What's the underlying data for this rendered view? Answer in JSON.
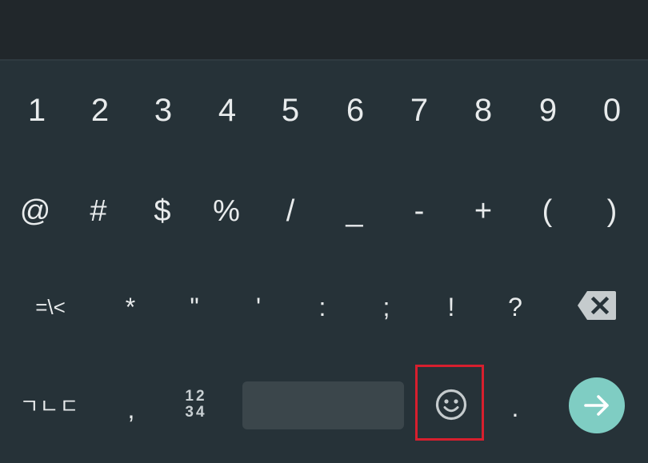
{
  "keyboard": {
    "row1": [
      "1",
      "2",
      "3",
      "4",
      "5",
      "6",
      "7",
      "8",
      "9",
      "0"
    ],
    "row2": [
      "@",
      "#",
      "$",
      "%",
      "/",
      "_",
      "-",
      "+",
      "(",
      ")"
    ],
    "row3": [
      "=\\<",
      "*",
      "\"",
      "'",
      ":",
      ";",
      "!",
      "?"
    ],
    "row4": {
      "language_key": "ㄱㄴㄷ",
      "comma": ",",
      "symbols_key_line1": "12",
      "symbols_key_line2": "34",
      "period": "."
    }
  }
}
